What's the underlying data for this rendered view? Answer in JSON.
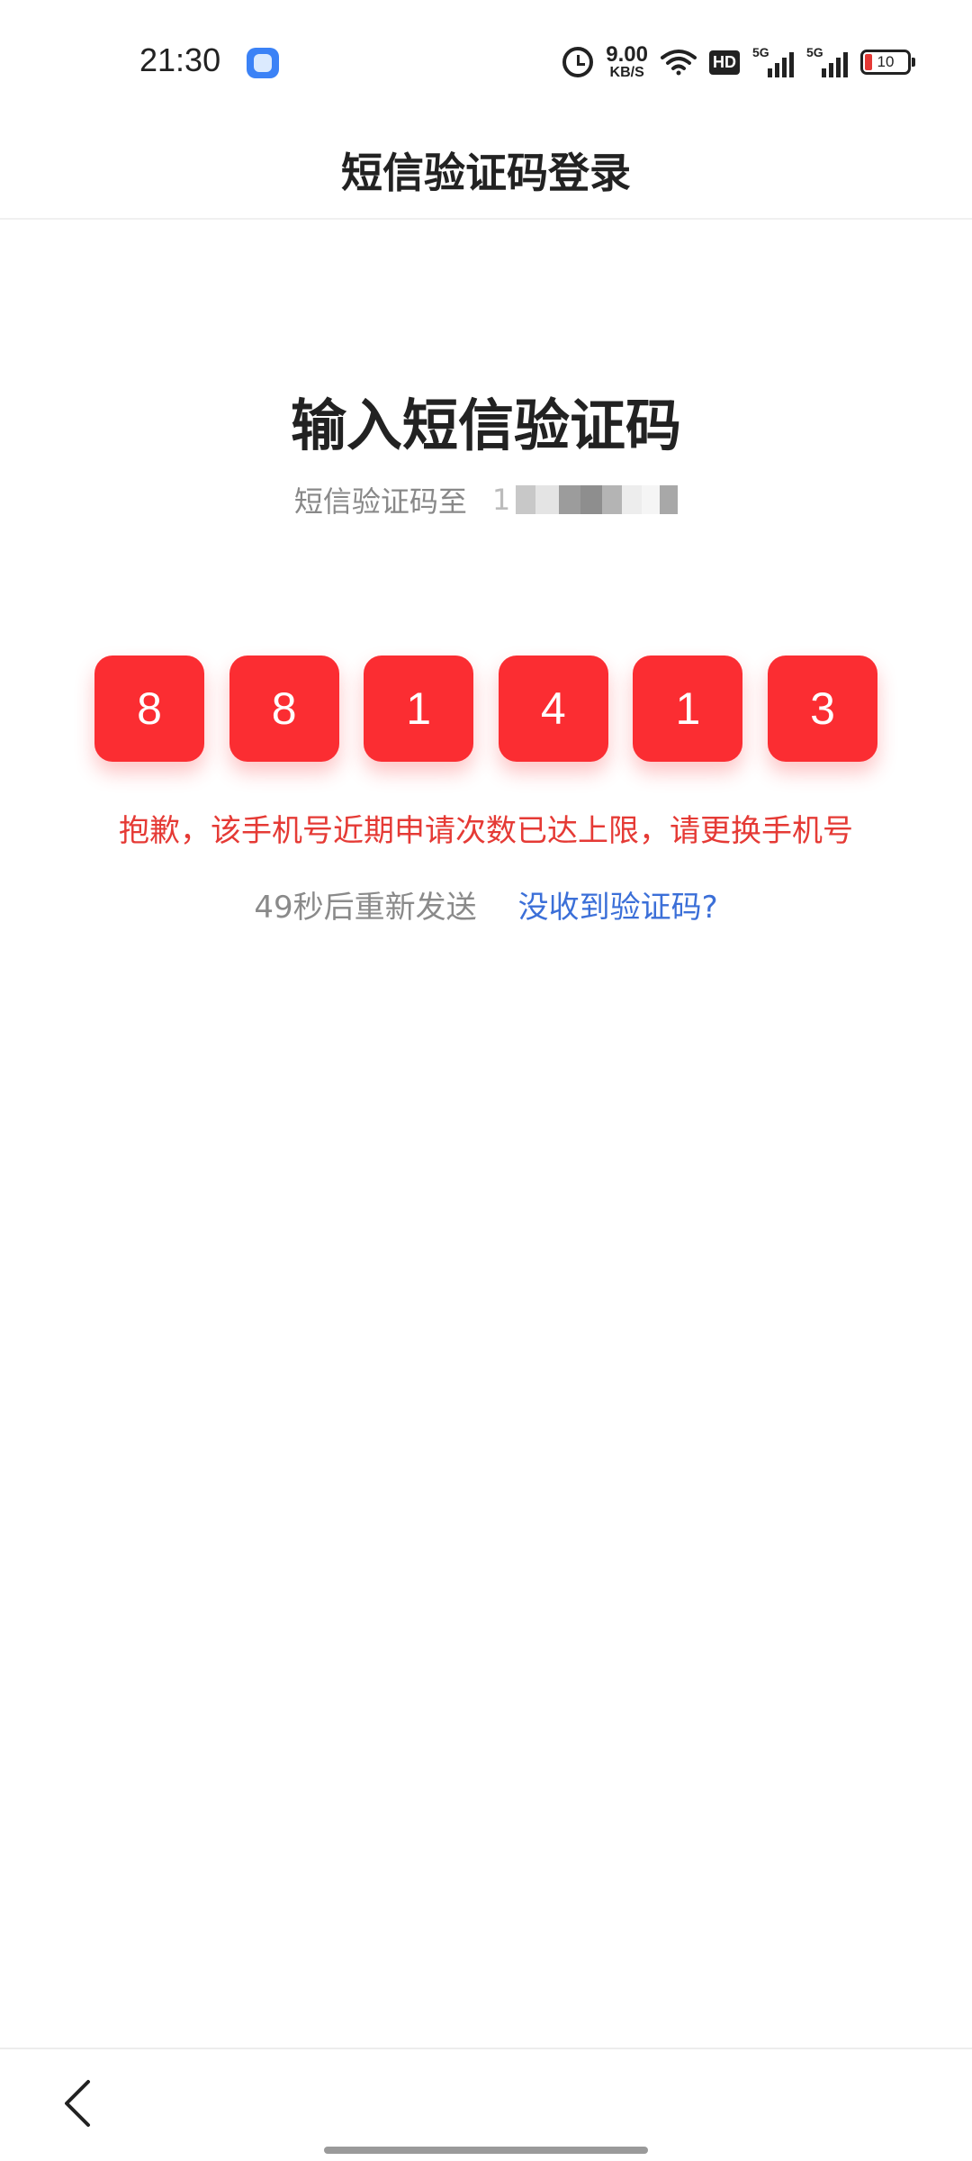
{
  "status_bar": {
    "time": "21:30",
    "app_icon": "app-notification-icon",
    "net_speed_value": "9.00",
    "net_speed_unit": "KB/S",
    "hd_label": "HD",
    "sim1_label": "5G",
    "sim2_label": "5G",
    "battery_level": "10",
    "battery_color": "#e53935"
  },
  "header": {
    "title": "短信验证码登录"
  },
  "main": {
    "title": "输入短信验证码",
    "subtitle": "短信验证码至",
    "phone_visible_prefix": "1"
  },
  "code": {
    "digits": [
      "8",
      "8",
      "1",
      "4",
      "1",
      "3"
    ],
    "box_color": "#fb2d32"
  },
  "error": {
    "message": "抱歉，该手机号近期申请次数已达上限，请更换手机号",
    "color": "#e53a35"
  },
  "resend": {
    "countdown": "49秒后重新发送",
    "no_code_link": "没收到验证码?",
    "link_color": "#3b6fd8"
  },
  "nav": {
    "back_icon": "chevron-left-icon"
  }
}
